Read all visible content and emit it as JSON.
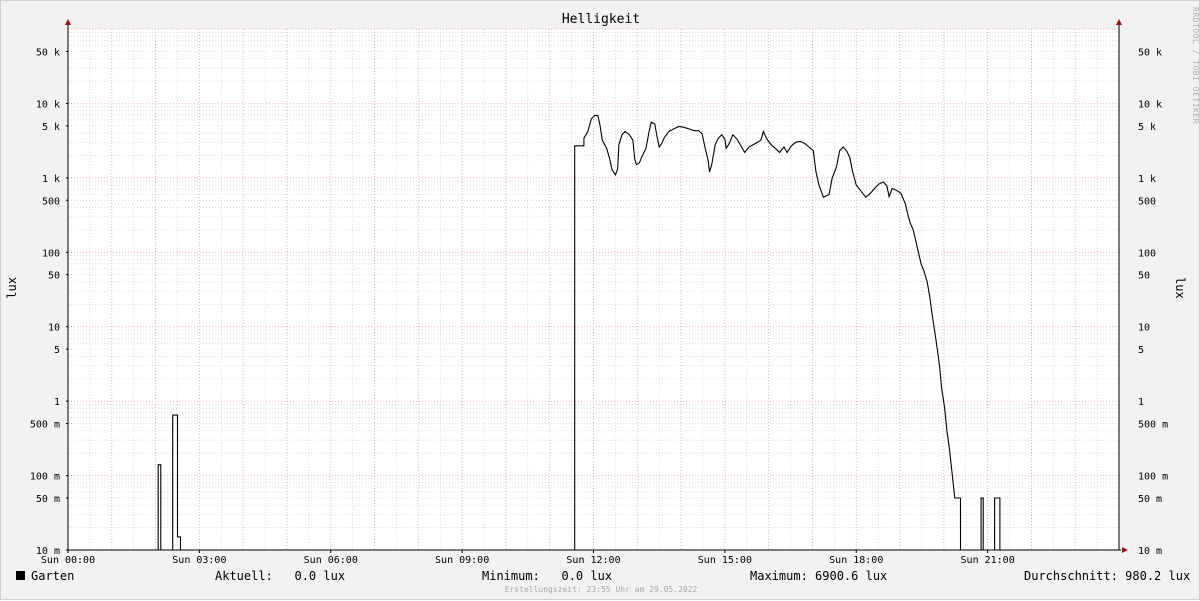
{
  "chart_data": {
    "type": "line",
    "title": "Helligkeit",
    "ylabel": "lux",
    "yscale": "log",
    "ylim": [
      0.01,
      100000
    ],
    "xlim": [
      0,
      24
    ],
    "x_unit": "hours",
    "x_ticks": [
      {
        "x": 0,
        "label": "Sun 00:00"
      },
      {
        "x": 3,
        "label": "Sun 03:00"
      },
      {
        "x": 6,
        "label": "Sun 06:00"
      },
      {
        "x": 9,
        "label": "Sun 09:00"
      },
      {
        "x": 12,
        "label": "Sun 12:00"
      },
      {
        "x": 15,
        "label": "Sun 15:00"
      },
      {
        "x": 18,
        "label": "Sun 18:00"
      },
      {
        "x": 21,
        "label": "Sun 21:00"
      }
    ],
    "y_ticks": [
      {
        "v": 50000,
        "label": "50 k"
      },
      {
        "v": 10000,
        "label": "10 k"
      },
      {
        "v": 5000,
        "label": "5 k"
      },
      {
        "v": 1000,
        "label": "1 k"
      },
      {
        "v": 500,
        "label": "500"
      },
      {
        "v": 100,
        "label": "100"
      },
      {
        "v": 50,
        "label": "50"
      },
      {
        "v": 10,
        "label": "10"
      },
      {
        "v": 5,
        "label": "5"
      },
      {
        "v": 1,
        "label": "1"
      },
      {
        "v": 0.5,
        "label": "500 m"
      },
      {
        "v": 0.1,
        "label": "100 m"
      },
      {
        "v": 0.05,
        "label": "50 m"
      },
      {
        "v": 0.01,
        "label": "10 m"
      }
    ],
    "grid": true,
    "legend": "bottom-left",
    "series": [
      {
        "name": "Garten",
        "color": "#000000",
        "points": [
          [
            0,
            0.01
          ],
          [
            2.06,
            0.01
          ],
          [
            2.06,
            0.14
          ],
          [
            2.12,
            0.14
          ],
          [
            2.12,
            0.01
          ],
          [
            2.39,
            0.01
          ],
          [
            2.39,
            0.65
          ],
          [
            2.5,
            0.65
          ],
          [
            2.5,
            0.015
          ],
          [
            2.57,
            0.015
          ],
          [
            2.57,
            0.01
          ],
          [
            11.57,
            0.01
          ],
          [
            11.57,
            2700
          ],
          [
            11.78,
            2700
          ],
          [
            11.78,
            3400
          ],
          [
            11.87,
            4200
          ],
          [
            11.95,
            6200
          ],
          [
            12.03,
            6900
          ],
          [
            12.1,
            6900
          ],
          [
            12.15,
            5000
          ],
          [
            12.2,
            3200
          ],
          [
            12.3,
            2500
          ],
          [
            12.37,
            1800
          ],
          [
            12.42,
            1300
          ],
          [
            12.5,
            1100
          ],
          [
            12.55,
            1300
          ],
          [
            12.58,
            2800
          ],
          [
            12.65,
            3800
          ],
          [
            12.72,
            4200
          ],
          [
            12.82,
            3800
          ],
          [
            12.9,
            3200
          ],
          [
            12.94,
            1800
          ],
          [
            12.98,
            1500
          ],
          [
            13.05,
            1600
          ],
          [
            13.1,
            1900
          ],
          [
            13.2,
            2500
          ],
          [
            13.27,
            4200
          ],
          [
            13.32,
            5600
          ],
          [
            13.4,
            5300
          ],
          [
            13.45,
            3600
          ],
          [
            13.5,
            2600
          ],
          [
            13.56,
            2900
          ],
          [
            13.62,
            3500
          ],
          [
            13.72,
            4200
          ],
          [
            13.85,
            4600
          ],
          [
            13.95,
            4900
          ],
          [
            14.05,
            4800
          ],
          [
            14.15,
            4600
          ],
          [
            14.3,
            4300
          ],
          [
            14.4,
            4300
          ],
          [
            14.48,
            3900
          ],
          [
            14.55,
            2500
          ],
          [
            14.62,
            1700
          ],
          [
            14.65,
            1200
          ],
          [
            14.7,
            1500
          ],
          [
            14.78,
            2800
          ],
          [
            14.85,
            3400
          ],
          [
            14.93,
            3800
          ],
          [
            15.0,
            3300
          ],
          [
            15.03,
            2500
          ],
          [
            15.1,
            2900
          ],
          [
            15.18,
            3800
          ],
          [
            15.28,
            3300
          ],
          [
            15.35,
            2800
          ],
          [
            15.45,
            2200
          ],
          [
            15.55,
            2600
          ],
          [
            15.7,
            2900
          ],
          [
            15.82,
            3200
          ],
          [
            15.88,
            4200
          ],
          [
            15.95,
            3400
          ],
          [
            16.05,
            2800
          ],
          [
            16.15,
            2500
          ],
          [
            16.25,
            2200
          ],
          [
            16.35,
            2600
          ],
          [
            16.42,
            2200
          ],
          [
            16.52,
            2700
          ],
          [
            16.62,
            3000
          ],
          [
            16.72,
            3100
          ],
          [
            16.82,
            2900
          ],
          [
            16.92,
            2600
          ],
          [
            17.02,
            2300
          ],
          [
            17.08,
            1200
          ],
          [
            17.15,
            800
          ],
          [
            17.25,
            550
          ],
          [
            17.38,
            600
          ],
          [
            17.45,
            1000
          ],
          [
            17.55,
            1400
          ],
          [
            17.62,
            2300
          ],
          [
            17.7,
            2600
          ],
          [
            17.78,
            2300
          ],
          [
            17.85,
            1900
          ],
          [
            17.92,
            1200
          ],
          [
            18.0,
            800
          ],
          [
            18.12,
            650
          ],
          [
            18.22,
            550
          ],
          [
            18.32,
            620
          ],
          [
            18.42,
            720
          ],
          [
            18.52,
            830
          ],
          [
            18.62,
            880
          ],
          [
            18.7,
            780
          ],
          [
            18.75,
            560
          ],
          [
            18.82,
            720
          ],
          [
            18.92,
            680
          ],
          [
            19.02,
            620
          ],
          [
            19.12,
            450
          ],
          [
            19.18,
            320
          ],
          [
            19.23,
            250
          ],
          [
            19.3,
            200
          ],
          [
            19.35,
            150
          ],
          [
            19.42,
            100
          ],
          [
            19.48,
            70
          ],
          [
            19.55,
            55
          ],
          [
            19.62,
            40
          ],
          [
            19.68,
            25
          ],
          [
            19.73,
            15
          ],
          [
            19.8,
            8
          ],
          [
            19.85,
            5
          ],
          [
            19.9,
            3
          ],
          [
            19.95,
            1.5
          ],
          [
            20.02,
            0.8
          ],
          [
            20.07,
            0.4
          ],
          [
            20.12,
            0.25
          ],
          [
            20.18,
            0.12
          ],
          [
            20.25,
            0.05
          ],
          [
            20.38,
            0.05
          ],
          [
            20.38,
            0.01
          ],
          [
            20.85,
            0.01
          ],
          [
            20.85,
            0.05
          ],
          [
            20.9,
            0.05
          ],
          [
            20.9,
            0.01
          ],
          [
            21.16,
            0.01
          ],
          [
            21.16,
            0.05
          ],
          [
            21.28,
            0.05
          ],
          [
            21.28,
            0.01
          ],
          [
            21.56,
            0.01
          ],
          [
            21.56,
            0.01
          ]
        ]
      }
    ]
  },
  "legend": {
    "series_name": "Garten",
    "current": "Aktuell:   0.0 lux",
    "minimum": "Minimum:   0.0 lux",
    "maximum": "Maximum: 6900.6 lux",
    "average": "Durchschnitt: 980.2 lux"
  },
  "watermark": "RRDTOOL / TOBI OETIKER",
  "footer": "Erstellungszeit: 23:55 Uhr am 29.05.2022"
}
